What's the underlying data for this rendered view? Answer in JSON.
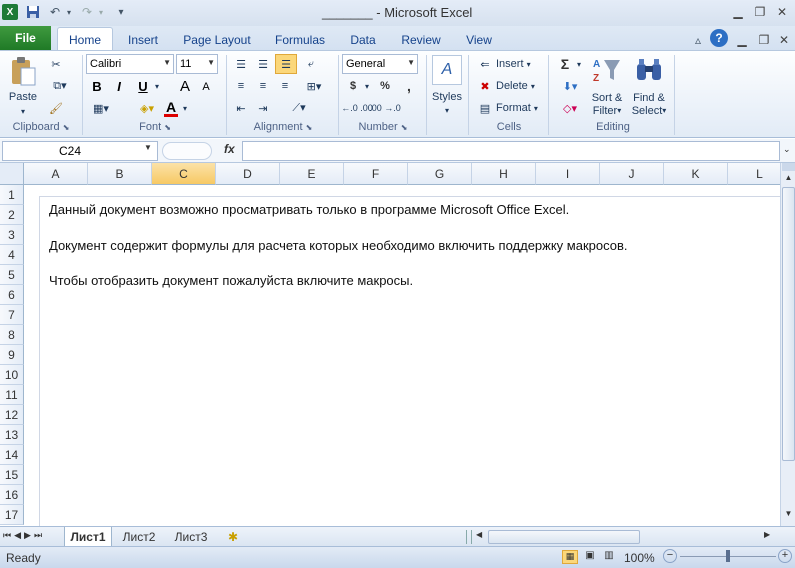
{
  "window": {
    "title": "Microsoft Excel",
    "title_prefix": "_______  -"
  },
  "tabs": {
    "file": "File",
    "items": [
      "Home",
      "Insert",
      "Page Layout",
      "Formulas",
      "Data",
      "Review",
      "View"
    ]
  },
  "ribbon": {
    "clipboard": {
      "paste": "Paste",
      "label": "Clipboard"
    },
    "font": {
      "name": "Calibri",
      "size": "11",
      "label": "Font",
      "bold": "B",
      "italic": "I",
      "underline": "U",
      "grow": "A",
      "shrink": "A",
      "font_color_glyph": "A"
    },
    "alignment": {
      "label": "Alignment"
    },
    "number": {
      "format": "General",
      "currency": "$",
      "percent": "%",
      "comma": ",",
      "label": "Number",
      "inc_decimal": "←.0 .00",
      "dec_decimal": ".00 →.0"
    },
    "styles": {
      "label": "Styles"
    },
    "cells": {
      "insert": "Insert",
      "delete": "Delete",
      "format": "Format",
      "label": "Cells"
    },
    "editing": {
      "sigma": "Σ",
      "sort_filter_1": "Sort &",
      "sort_filter_2": "Filter",
      "find_select_1": "Find &",
      "find_select_2": "Select",
      "label": "Editing"
    }
  },
  "formula_bar": {
    "name_box": "C24",
    "fx": "fx",
    "value": ""
  },
  "grid": {
    "columns": [
      "A",
      "B",
      "C",
      "D",
      "E",
      "F",
      "G",
      "H",
      "I",
      "J",
      "K",
      "L"
    ],
    "selected_column": "C",
    "rows": [
      "1",
      "2",
      "3",
      "4",
      "5",
      "6",
      "7",
      "8",
      "9",
      "10",
      "11",
      "12",
      "13",
      "14",
      "15",
      "16",
      "17"
    ],
    "messages": [
      "Данный документ возможно просматривать только в программе Microsoft Office Excel.",
      "Документ содержит формулы для расчета которых необходимо включить поддержку макросов.",
      "Чтобы отобразить документ пожалуйста включите макросы."
    ]
  },
  "sheets": [
    "Лист1",
    "Лист2",
    "Лист3"
  ],
  "status": {
    "ready": "Ready",
    "zoom": "100%",
    "zoom_out": "−",
    "zoom_in": "+"
  },
  "colors": {
    "file_tab": "#1f7a26",
    "selected_header": "#f7c964",
    "ribbon_bg": "#e2ebf6"
  }
}
